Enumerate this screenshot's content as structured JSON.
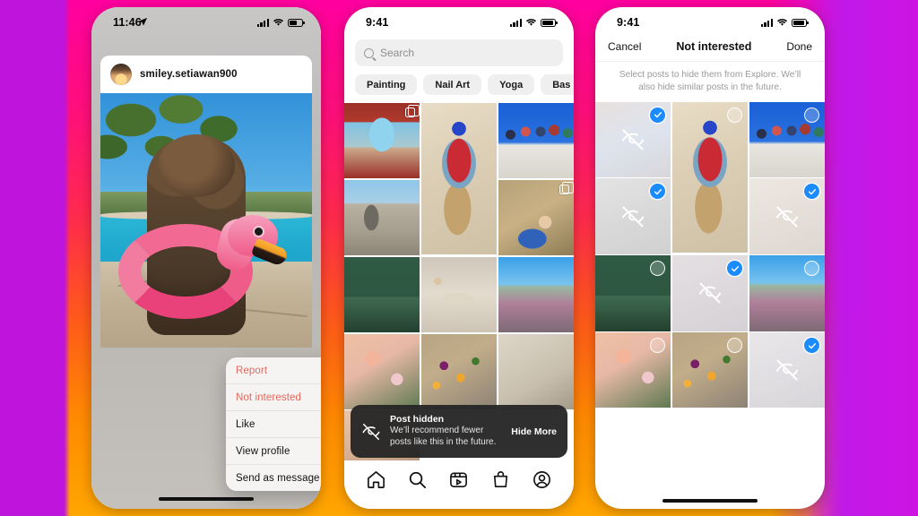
{
  "background": {
    "accent_magenta": "#ff00a0",
    "accent_orange": "#ffa600",
    "accent_purple": "#c21be0"
  },
  "phone1": {
    "status": {
      "time": "11:46",
      "location_icon": "location-arrow-icon",
      "signal_icon": "cellular-signal-icon",
      "wifi_icon": "wifi-icon",
      "battery_icon": "battery-icon"
    },
    "post": {
      "username": "smiley.setiawan900",
      "avatar": "user-avatar",
      "photo_alt": "dog-in-flamingo-float"
    },
    "menu": [
      {
        "label": "Report",
        "style": "danger"
      },
      {
        "label": "Not interested",
        "style": "danger"
      },
      {
        "label": "Like",
        "style": "normal"
      },
      {
        "label": "View profile",
        "style": "normal"
      },
      {
        "label": "Send as message",
        "style": "normal"
      }
    ]
  },
  "phone2": {
    "status": {
      "time": "9:41",
      "signal_icon": "cellular-signal-icon",
      "wifi_icon": "wifi-icon",
      "battery_icon": "battery-icon"
    },
    "search": {
      "placeholder": "Search",
      "value": "",
      "icon": "search-icon"
    },
    "chips": [
      "Painting",
      "Nail Art",
      "Yoga",
      "Bas"
    ],
    "grid": [
      {
        "name": "arch-view",
        "class": "im-arch",
        "span": 1,
        "carousel": true
      },
      {
        "name": "dancer",
        "class": "im-dancer",
        "span": 2,
        "carousel": false
      },
      {
        "name": "friends-group",
        "class": "im-friends",
        "span": 1,
        "carousel": false
      },
      {
        "name": "stone-arch",
        "class": "im-arch2",
        "span": 1,
        "carousel": false
      },
      {
        "name": "person-lying",
        "class": "im-lying",
        "span": 1,
        "carousel": true
      },
      {
        "name": "green-dining-room",
        "class": "im-green",
        "span": 1,
        "carousel": false
      },
      {
        "name": "food-prep",
        "class": "im-food",
        "span": 1,
        "carousel": false
      },
      {
        "name": "coastline",
        "class": "im-coast",
        "span": 1,
        "carousel": false
      },
      {
        "name": "flowers",
        "class": "im-flowers",
        "span": 1,
        "carousel": false
      },
      {
        "name": "roasted-vegetables",
        "class": "im-veg",
        "span": 1,
        "carousel": false
      },
      {
        "name": "plate",
        "class": "im-plate",
        "span": 1,
        "carousel": false
      },
      {
        "name": "hand",
        "class": "im-hand",
        "span": 1,
        "carousel": false
      }
    ],
    "toast": {
      "icon": "eye-hidden-icon",
      "title": "Post hidden",
      "subtitle": "We’ll recommend fewer posts like this in the future.",
      "action": "Hide More"
    },
    "tabs": [
      {
        "name": "home-icon"
      },
      {
        "name": "search-icon"
      },
      {
        "name": "reels-icon"
      },
      {
        "name": "shop-icon"
      },
      {
        "name": "profile-icon"
      }
    ]
  },
  "phone3": {
    "status": {
      "time": "9:41",
      "signal_icon": "cellular-signal-icon",
      "wifi_icon": "wifi-icon",
      "battery_icon": "battery-icon"
    },
    "header": {
      "cancel": "Cancel",
      "title": "Not interested",
      "done": "Done"
    },
    "subtitle": "Select posts to hide them from Explore. We’ll also hide similar posts in the future.",
    "grid": [
      {
        "name": "arch-view",
        "class": "im-blur1",
        "span": 1,
        "selected": true
      },
      {
        "name": "dancer",
        "class": "im-dancer",
        "span": 2,
        "selected": false
      },
      {
        "name": "friends-group",
        "class": "im-friends",
        "span": 1,
        "selected": false
      },
      {
        "name": "stone-arch",
        "class": "im-blur2",
        "span": 1,
        "selected": true
      },
      {
        "name": "person-lying",
        "class": "im-blur3",
        "span": 1,
        "selected": true
      },
      {
        "name": "green-dining-room",
        "class": "im-green",
        "span": 1,
        "selected": false
      },
      {
        "name": "food-prep",
        "class": "im-blur4",
        "span": 1,
        "selected": true
      },
      {
        "name": "coastline",
        "class": "im-coast",
        "span": 1,
        "selected": false
      },
      {
        "name": "flowers",
        "class": "im-flowers",
        "span": 1,
        "selected": false
      },
      {
        "name": "roasted-vegetables",
        "class": "im-veg",
        "span": 1,
        "selected": false
      },
      {
        "name": "hand",
        "class": "im-blur5",
        "span": 1,
        "selected": true
      }
    ]
  }
}
